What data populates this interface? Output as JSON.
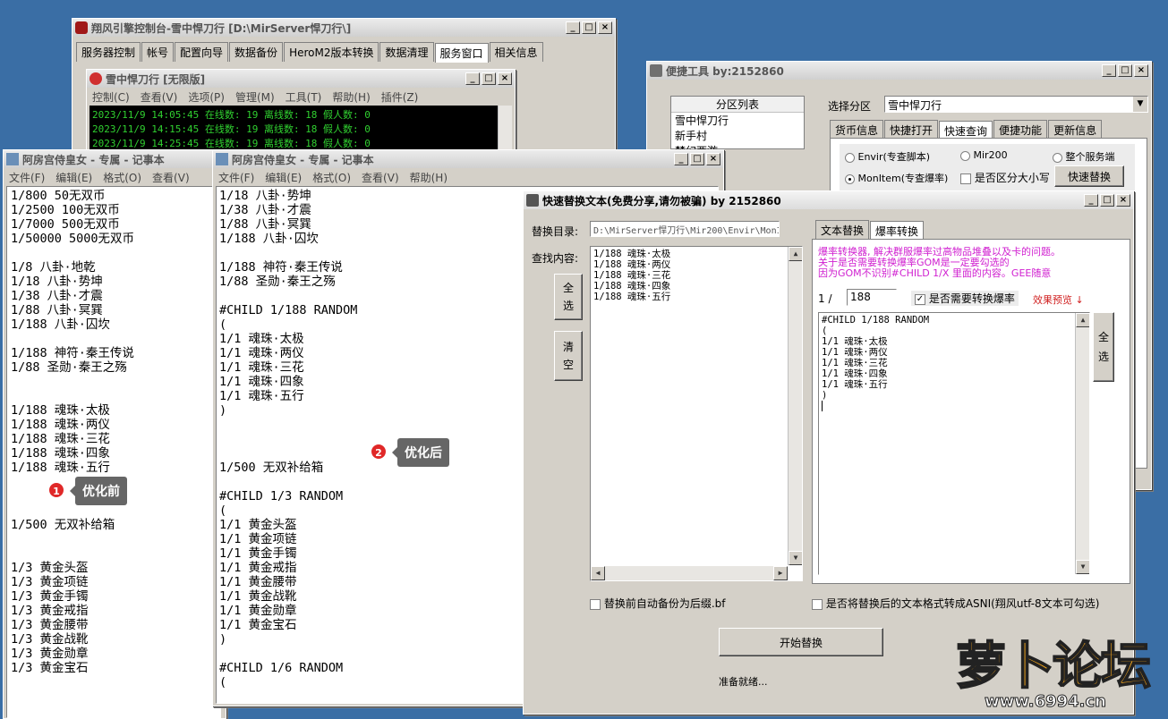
{
  "console": {
    "title": "翔风引擎控制台-雪中悍刀行 [D:\\MirServer悍刀行\\]",
    "tabs": [
      "服务器控制",
      "帐号",
      "配置向导",
      "数据备份",
      "HeroM2版本转换",
      "数据清理",
      "服务窗口",
      "相关信息"
    ],
    "inner": {
      "title": "雪中悍刀行 [无限版]",
      "menu": [
        "控制(C)",
        "查看(V)",
        "选项(P)",
        "管理(M)",
        "工具(T)",
        "帮助(H)",
        "插件(Z)"
      ],
      "log": [
        "2023/11/9 14:05:45 在线数: 19 离线数: 18 假人数: 0",
        "2023/11/9 14:15:45 在线数: 19 离线数: 18 假人数: 0",
        "2023/11/9 14:25:45 在线数: 19 离线数: 18 假人数: 0"
      ]
    }
  },
  "quicktool": {
    "title": "便捷工具   by:2152860",
    "partition_header": "分区列表",
    "partitions": [
      "雪中悍刀行",
      "新手村",
      "梦幻西游"
    ],
    "select_label": "选择分区",
    "select_value": "雪中悍刀行",
    "tabs": [
      "货币信息",
      "快捷打开",
      "快速查询",
      "便捷功能",
      "更新信息"
    ],
    "radios": [
      "Envir(专查脚本)",
      "Mir200",
      "整个服务端",
      "MonItem(专查爆率)"
    ],
    "case_label": "是否区分大小写",
    "replace_btn": "快速替换"
  },
  "notepad1": {
    "title": "阿房宫侍皇女 - 专属 - 记事本",
    "menu": [
      "文件(F)",
      "编辑(E)",
      "格式(O)",
      "查看(V)"
    ],
    "lines": [
      "1/800 50无双币",
      "1/2500 100无双币",
      "1/7000 500无双币",
      "1/50000 5000无双币",
      "",
      "1/8 八卦·地乾",
      "1/18 八卦·势坤",
      "1/38 八卦·才震",
      "1/88 八卦·冥巽",
      "1/188 八卦·囚坎",
      "",
      "1/188 神符·秦王传说",
      "1/88 圣勋·秦王之殇",
      "",
      "",
      "1/188 魂珠·太极",
      "1/188 魂珠·两仪",
      "1/188 魂珠·三花",
      "1/188 魂珠·四象",
      "1/188 魂珠·五行",
      "",
      "",
      "",
      "1/500 无双补给箱",
      "",
      "",
      "1/3 黄金头盔",
      "1/3 黄金项链",
      "1/3 黄金手镯",
      "1/3 黄金戒指",
      "1/3 黄金腰带",
      "1/3 黄金战靴",
      "1/3 黄金勋章",
      "1/3 黄金宝石"
    ]
  },
  "notepad2": {
    "title": "阿房宫侍皇女 - 专属 - 记事本",
    "menu": [
      "文件(F)",
      "编辑(E)",
      "格式(O)",
      "查看(V)",
      "帮助(H)"
    ],
    "lines": [
      "1/18 八卦·势坤",
      "1/38 八卦·才震",
      "1/88 八卦·冥巽",
      "1/188 八卦·囚坎",
      "",
      "1/188 神符·秦王传说",
      "1/88 圣勋·秦王之殇",
      "",
      "#CHILD 1/188 RANDOM",
      "(",
      "1/1 魂珠·太极",
      "1/1 魂珠·两仪",
      "1/1 魂珠·三花",
      "1/1 魂珠·四象",
      "1/1 魂珠·五行",
      ")",
      "",
      "",
      "",
      "1/500 无双补给箱",
      "",
      "#CHILD 1/3 RANDOM",
      "(",
      "1/1 黄金头盔",
      "1/1 黄金项链",
      "1/1 黄金手镯",
      "1/1 黄金戒指",
      "1/1 黄金腰带",
      "1/1 黄金战靴",
      "1/1 黄金勋章",
      "1/1 黄金宝石",
      ")",
      "",
      "#CHILD 1/6 RANDOM",
      "("
    ]
  },
  "replacer": {
    "title": "快速替换文本(免费分享,请勿被骗)    by 2152860",
    "dir_label": "替换目录:",
    "dir_value": "D:\\MirServer悍刀行\\Mir200\\Envir\\MonItems",
    "find_label": "查找内容:",
    "select_all": "全\n选",
    "clear": "清\n空",
    "find_lines": [
      "1/188 魂珠·太极",
      "1/188 魂珠·两仪",
      "1/188 魂珠·三花",
      "1/188 魂珠·四象",
      "1/188 魂珠·五行"
    ],
    "tabs": [
      "文本替换",
      "爆率转换"
    ],
    "desc": [
      "爆率转换器, 解决群服爆率过高物品堆叠以及卡的问题。",
      "关于是否需要转换爆率GOM是一定要勾选的",
      "因为GOM不识别#CHILD 1/X 里面的内容。GEE随意"
    ],
    "rate_prefix": "1 /",
    "rate_value": "188",
    "convert_label": "是否需要转换爆率",
    "preview_label": "效果预览 ↓",
    "preview_lines": [
      "#CHILD 1/188 RANDOM",
      "(",
      "1/1 魂珠·太极",
      "1/1 魂珠·两仪",
      "1/1 魂珠·三花",
      "1/1 魂珠·四象",
      "1/1 魂珠·五行",
      ")"
    ],
    "backup_label": "替换前自动备份为后缀.bf",
    "ansi_label": "是否将替换后的文本格式转成ASNI(翔风utf-8文本可勾选)",
    "start_btn": "开始替换",
    "status": "准备就绪..."
  },
  "annotations": {
    "badge1": "1",
    "label1": "优化前",
    "badge2": "2",
    "label2": "优化后"
  },
  "watermark": {
    "text": "萝卜论坛",
    "url": "www.6994.cn"
  }
}
